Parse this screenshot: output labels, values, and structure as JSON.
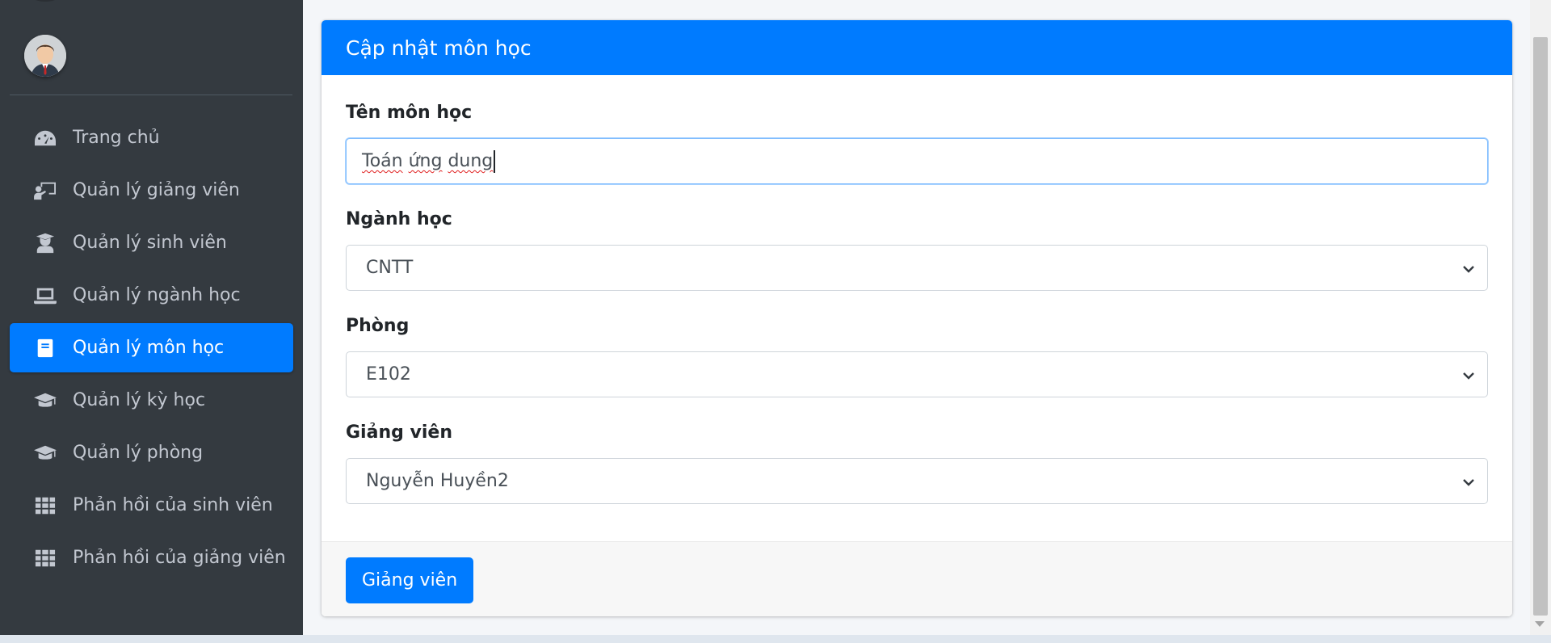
{
  "sidebar": {
    "avatar_alt": "user avatar",
    "items": [
      {
        "label": "Trang chủ",
        "icon": "dashboard-icon",
        "active": false
      },
      {
        "label": "Quản lý giảng viên",
        "icon": "chalkboard-teacher-icon",
        "active": false
      },
      {
        "label": "Quản lý sinh viên",
        "icon": "user-graduate-icon",
        "active": false
      },
      {
        "label": "Quản lý ngành học",
        "icon": "laptop-icon",
        "active": false
      },
      {
        "label": "Quản lý môn học",
        "icon": "book-icon",
        "active": true
      },
      {
        "label": "Quản lý kỳ học",
        "icon": "graduation-cap-icon",
        "active": false
      },
      {
        "label": "Quản lý phòng",
        "icon": "graduation-cap-icon",
        "active": false
      },
      {
        "label": "Phản hồi của sinh viên",
        "icon": "grid-icon",
        "active": false
      },
      {
        "label": "Phản hồi của giảng viên",
        "icon": "grid-icon",
        "active": false
      }
    ]
  },
  "card": {
    "title": "Cập nhật môn học",
    "fields": {
      "subject_name": {
        "label": "Tên môn học",
        "value_word1": "Toán",
        "value_word2": "ứng",
        "value_word3": "dung"
      },
      "major": {
        "label": "Ngành học",
        "value": "CNTT"
      },
      "room": {
        "label": "Phòng",
        "value": "E102"
      },
      "lecturer": {
        "label": "Giảng viên",
        "value": "Nguyễn Huyền2"
      }
    },
    "submit_label": "Giảng viên"
  },
  "colors": {
    "primary": "#007bff",
    "sidebar_bg": "#343a40"
  }
}
